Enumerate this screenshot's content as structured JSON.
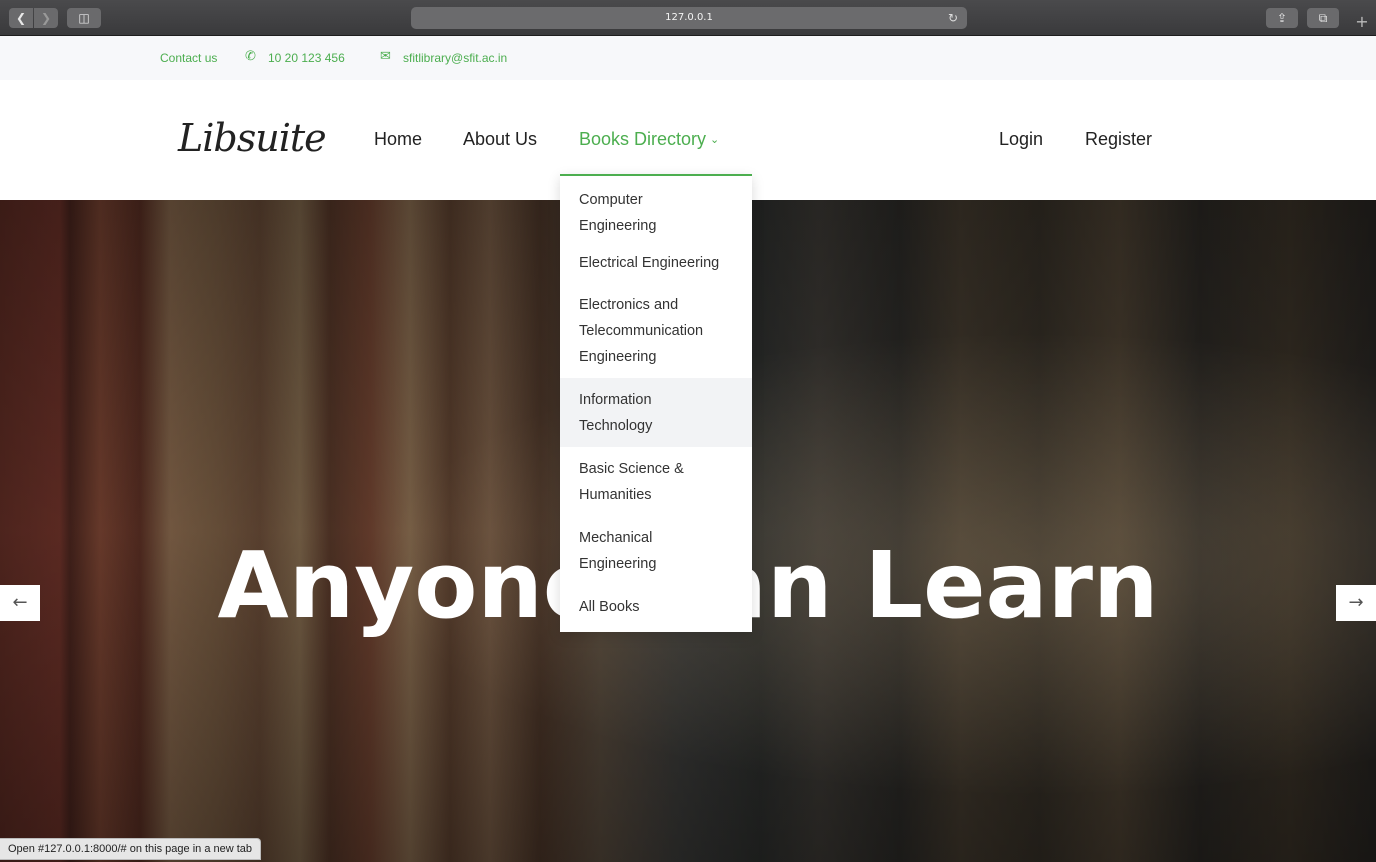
{
  "browser": {
    "url": "127.0.0.1",
    "back_glyph": "❮",
    "forward_glyph": "❯",
    "sidebar_glyph": "◫",
    "reload_glyph": "↻",
    "share_glyph": "⇪",
    "tabs_glyph": "⧉",
    "plus_glyph": "+"
  },
  "topbar": {
    "contact_label": "Contact us",
    "phone_icon": "phone-icon",
    "phone": "10 20 123 456",
    "mail_icon": "mail-icon",
    "email": "sfitlibrary@sfit.ac.in",
    "accent_color": "#4cae4f"
  },
  "nav": {
    "logo": "Libsuite",
    "links": [
      {
        "label": "Home"
      },
      {
        "label": "About Us"
      },
      {
        "label": "Books Directory"
      },
      {
        "label": "Login"
      },
      {
        "label": "Register"
      }
    ],
    "chevron": "⌄"
  },
  "dropdown": {
    "items": [
      {
        "lines": [
          "Computer",
          "Engineering"
        ]
      },
      {
        "lines": [
          "Electrical Engineering"
        ]
      },
      {
        "lines": [
          "Electronics and",
          "Telecommunication",
          "Engineering"
        ]
      },
      {
        "lines": [
          "Information",
          "Technology"
        ],
        "highlighted": true
      },
      {
        "lines": [
          "Basic Science &",
          "Humanities"
        ]
      },
      {
        "lines": [
          "Mechanical",
          "Engineering"
        ]
      },
      {
        "lines": [
          "All Books"
        ]
      }
    ]
  },
  "hero": {
    "title": "Anyone Can Learn",
    "prev_arrow": "←",
    "next_arrow": "→"
  },
  "status_bar": {
    "text": "Open #127.0.0.1:8000/# on this page in a new tab"
  }
}
